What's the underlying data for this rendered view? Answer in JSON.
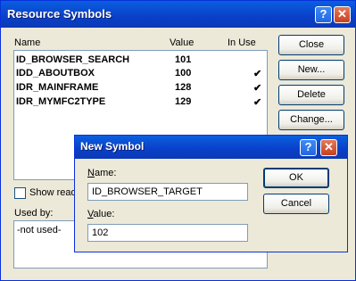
{
  "window": {
    "title": "Resource Symbols",
    "help_glyph": "?",
    "close_glyph": "✕"
  },
  "columns": {
    "name": "Name",
    "value": "Value",
    "in_use": "In Use"
  },
  "symbols": [
    {
      "name": "ID_BROWSER_SEARCH",
      "value": "101",
      "in_use": ""
    },
    {
      "name": "IDD_ABOUTBOX",
      "value": "100",
      "in_use": "✔"
    },
    {
      "name": "IDR_MAINFRAME",
      "value": "128",
      "in_use": "✔"
    },
    {
      "name": "IDR_MYMFC2TYPE",
      "value": "129",
      "in_use": "✔"
    }
  ],
  "buttons": {
    "close": "Close",
    "new": "New...",
    "delete": "Delete",
    "change": "Change..."
  },
  "show_readonly": {
    "label": "Show read",
    "checked": false
  },
  "used_by": {
    "label": "Used by:",
    "value": "-not used-"
  },
  "new_symbol": {
    "title": "New Symbol",
    "help_glyph": "?",
    "close_glyph": "✕",
    "name_label_key": "N",
    "name_label_rest": "ame:",
    "name_value": "ID_BROWSER_TARGET",
    "value_label_key": "V",
    "value_label_rest": "alue:",
    "value_value": "102",
    "ok": "OK",
    "cancel": "Cancel"
  }
}
